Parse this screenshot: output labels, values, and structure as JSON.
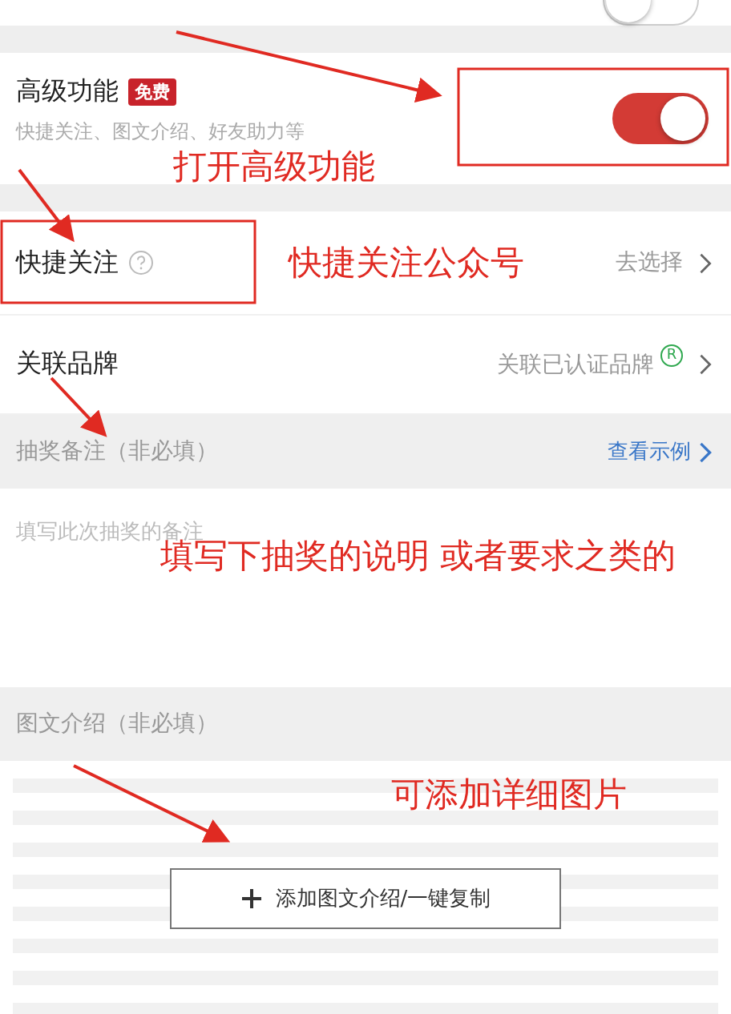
{
  "top_toggle": {
    "on": false
  },
  "advanced": {
    "title": "高级功能",
    "badge": "免费",
    "subtitle": "快捷关注、图文介绍、好友助力等",
    "on": true
  },
  "rows": [
    {
      "kind": "help",
      "label": "快捷关注",
      "value": "去选择"
    },
    {
      "kind": "brand",
      "label": "关联品牌",
      "value": "关联已认证品牌",
      "mark": "R"
    }
  ],
  "note_section": {
    "title": "抽奖备注（非必填）",
    "link": "查看示例"
  },
  "note_field": {
    "placeholder": "填写此次抽奖的备注"
  },
  "intro_section": {
    "title": "图文介绍（非必填）"
  },
  "add_button": {
    "label": "添加图文介绍/一键复制"
  },
  "annotations": [
    "打开高级功能",
    "快捷关注公众号",
    "填写下抽奖的说明 或者要求之类的",
    "可添加详细图片"
  ]
}
